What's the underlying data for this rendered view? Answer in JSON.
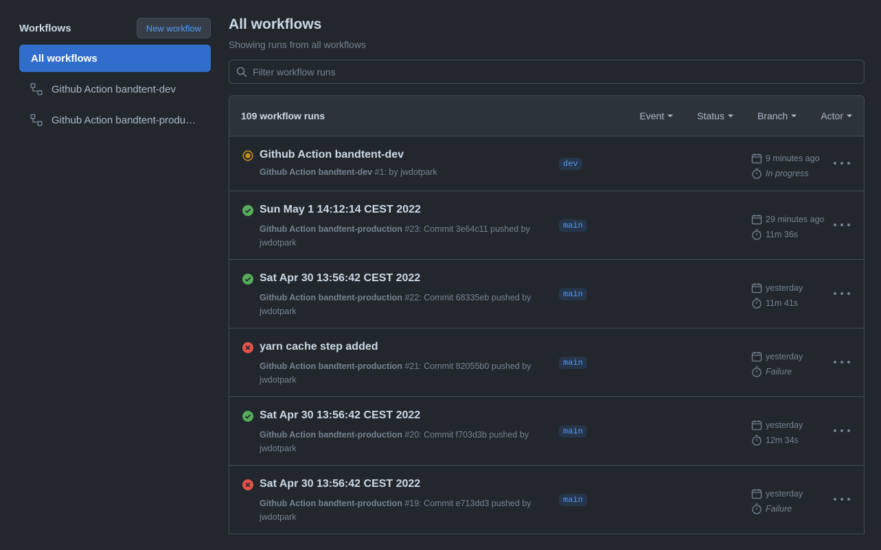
{
  "sidebar": {
    "title": "Workflows",
    "new_button": "New workflow",
    "items": [
      {
        "label": "All workflows"
      },
      {
        "label": "Github Action bandtent-dev"
      },
      {
        "label": "Github Action bandtent-production"
      }
    ]
  },
  "main": {
    "title": "All workflows",
    "subtitle": "Showing runs from all workflows",
    "filter_placeholder": "Filter workflow runs",
    "run_count": "109 workflow runs",
    "filters": [
      "Event",
      "Status",
      "Branch",
      "Actor"
    ]
  },
  "runs": [
    {
      "status": "in_progress",
      "title": "Github Action bandtent-dev",
      "workflow": "Github Action bandtent-dev",
      "detail": " #1: by jwdotpark",
      "branch": "dev",
      "time": "9 minutes ago",
      "duration": "In progress"
    },
    {
      "status": "success",
      "title": "Sun May 1 14:12:14 CEST 2022",
      "workflow": "Github Action bandtent-production",
      "detail": " #23: Commit 3e64c11 pushed by jwdotpark",
      "branch": "main",
      "time": "29 minutes ago",
      "duration": "11m 36s"
    },
    {
      "status": "success",
      "title": "Sat Apr 30 13:56:42 CEST 2022",
      "workflow": "Github Action bandtent-production",
      "detail": " #22: Commit 68335eb pushed by jwdotpark",
      "branch": "main",
      "time": "yesterday",
      "duration": "11m 41s"
    },
    {
      "status": "failure",
      "title": "yarn cache step added",
      "workflow": "Github Action bandtent-production",
      "detail": " #21: Commit 82055b0 pushed by jwdotpark",
      "branch": "main",
      "time": "yesterday",
      "duration": "Failure"
    },
    {
      "status": "success",
      "title": "Sat Apr 30 13:56:42 CEST 2022",
      "workflow": "Github Action bandtent-production",
      "detail": " #20: Commit f703d3b pushed by jwdotpark",
      "branch": "main",
      "time": "yesterday",
      "duration": "12m 34s"
    },
    {
      "status": "failure",
      "title": "Sat Apr 30 13:56:42 CEST 2022",
      "workflow": "Github Action bandtent-production",
      "detail": " #19: Commit e713dd3 pushed by jwdotpark",
      "branch": "main",
      "time": "yesterday",
      "duration": "Failure"
    }
  ],
  "colors": {
    "success": "#57ab5a",
    "failure": "#e5534b",
    "in_progress": "#c69026",
    "accent": "#316dca",
    "link": "#539bf5"
  }
}
